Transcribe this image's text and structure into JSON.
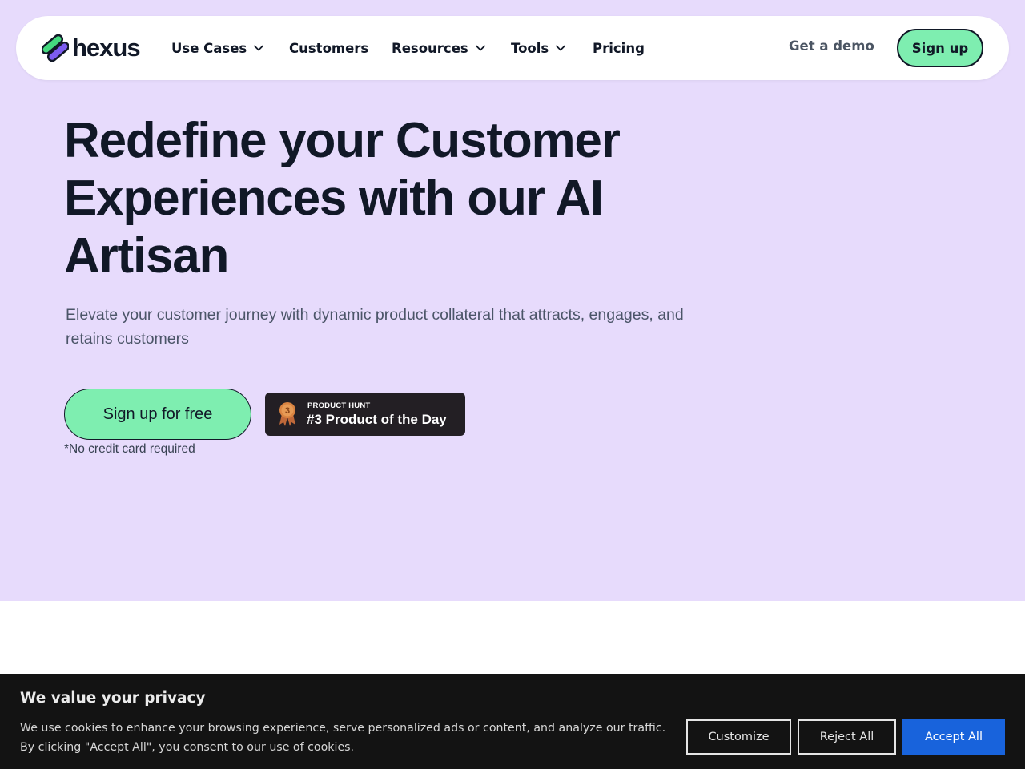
{
  "brand": {
    "name": "hexus",
    "logo_colors": {
      "green": "#44d97e",
      "purple": "#7c5cf0",
      "outline": "#111827"
    }
  },
  "nav": {
    "items": [
      {
        "label": "Use Cases",
        "has_dropdown": true
      },
      {
        "label": "Customers",
        "has_dropdown": false
      },
      {
        "label": "Resources",
        "has_dropdown": true
      },
      {
        "label": "Tools",
        "has_dropdown": true
      },
      {
        "label": "Pricing",
        "has_dropdown": false
      }
    ],
    "demo_label": "Get a demo",
    "signup_label": "Sign up"
  },
  "hero": {
    "headline": "Redefine your Customer Experiences with our AI Artisan",
    "subheadline": "Elevate your customer journey with dynamic product collateral that attracts, engages, and retains customers",
    "cta_label": "Sign up for free",
    "cta_note": "*No credit card required",
    "product_hunt": {
      "eyebrow": "PRODUCT HUNT",
      "title": "#3 Product of the Day",
      "rank": "3",
      "medal_icon": "bronze-medal-icon"
    }
  },
  "cookie_banner": {
    "title": "We value your privacy",
    "text": "We use cookies to enhance your browsing experience, serve personalized ads or content, and analyze our traffic. By clicking \"Accept All\", you consent to our use of cookies.",
    "customize_label": "Customize",
    "reject_label": "Reject All",
    "accept_label": "Accept All"
  },
  "colors": {
    "hero_bg": "#e7dbfc",
    "accent_green": "#7eeeb0",
    "text_dark": "#111827",
    "banner_bg": "#131313",
    "accept_blue": "#1863dc"
  }
}
